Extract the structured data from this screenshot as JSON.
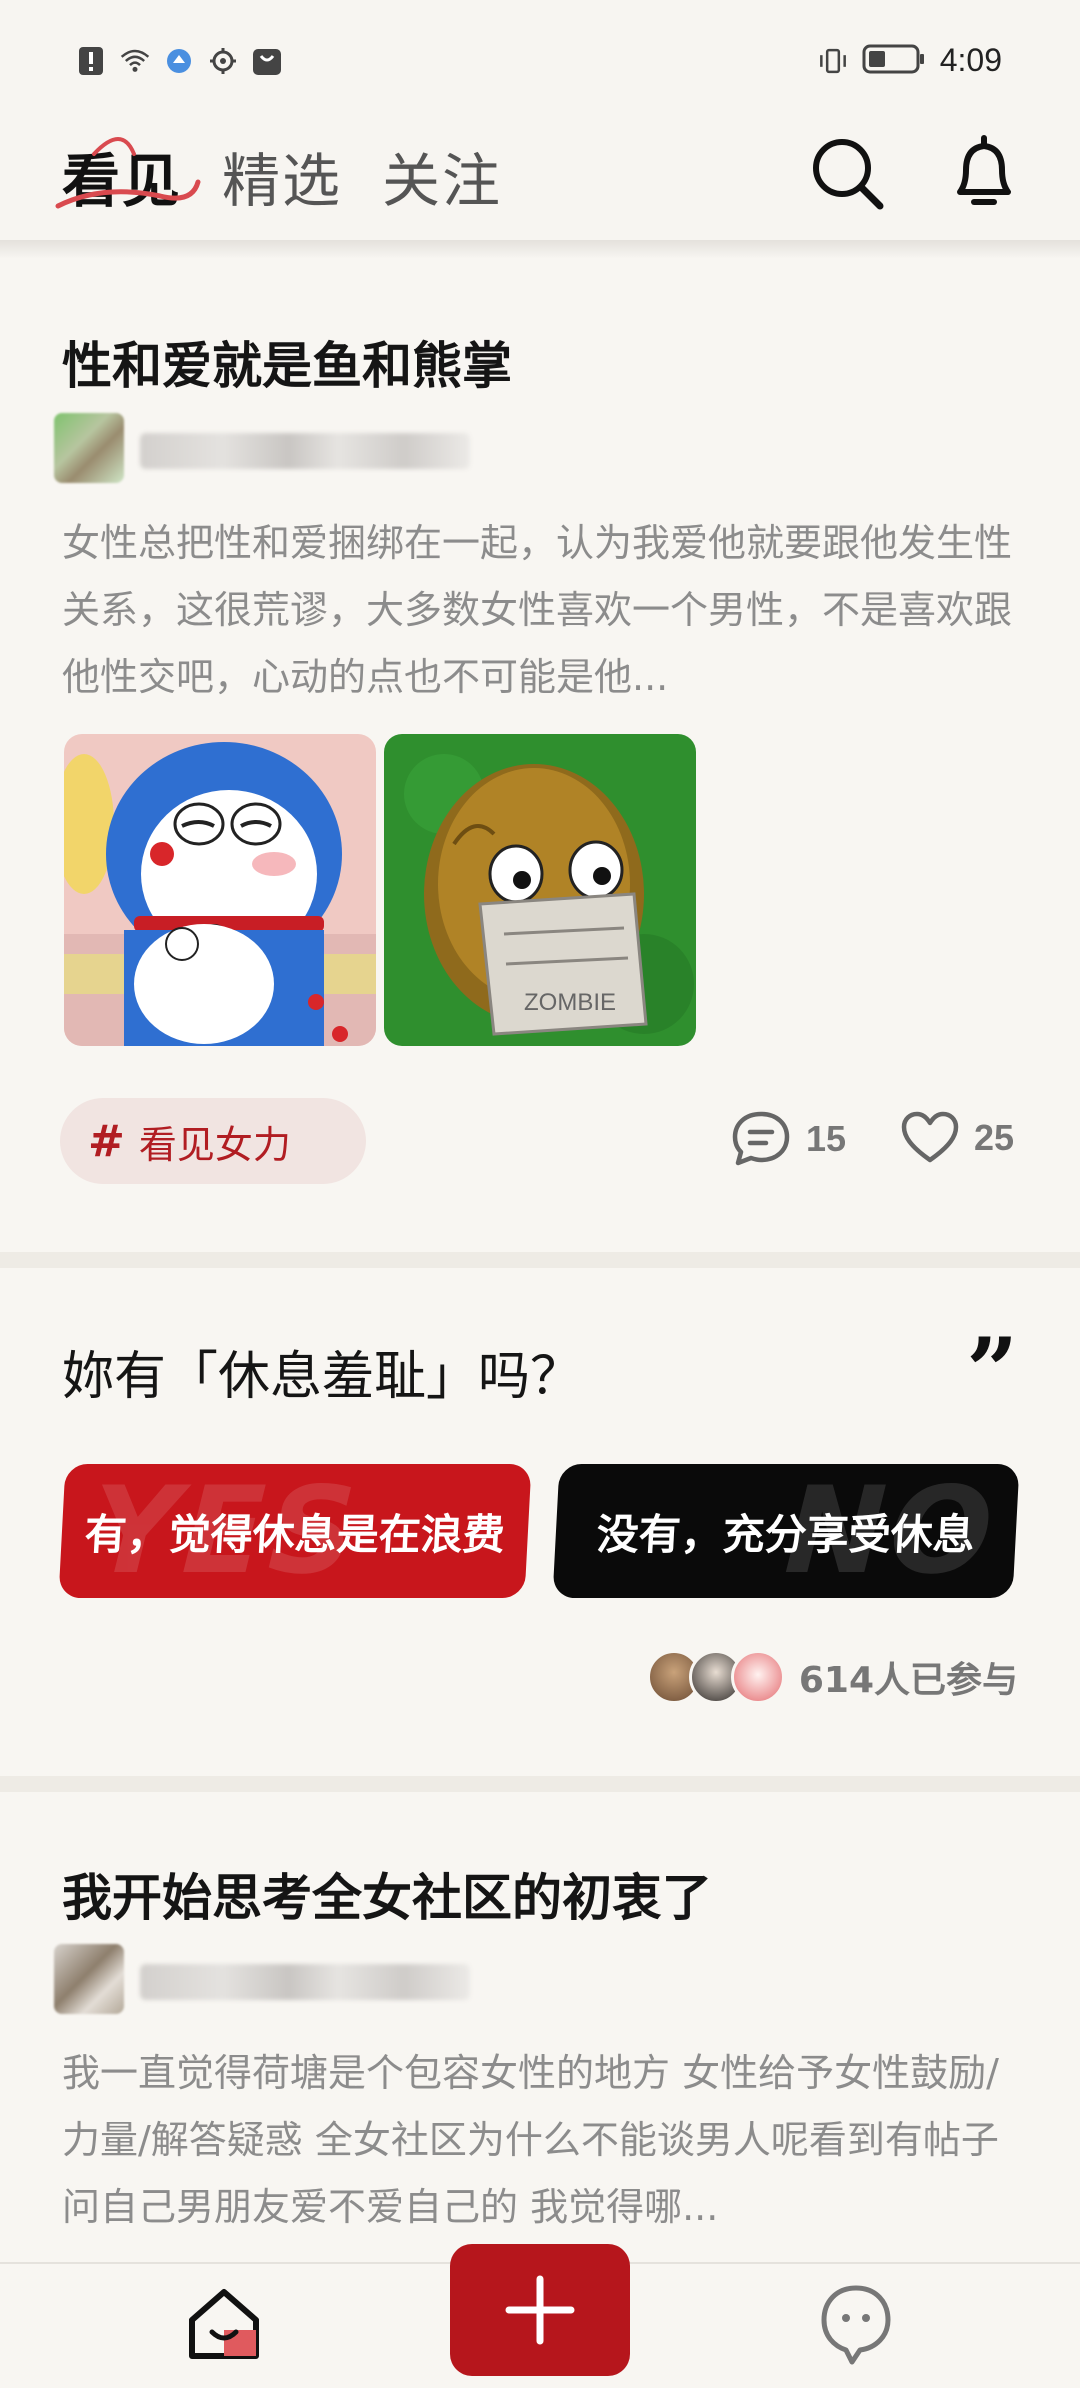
{
  "status_bar": {
    "time": "4:09"
  },
  "header": {
    "tabs": [
      {
        "label": "看见"
      },
      {
        "label": "精选"
      },
      {
        "label": "关注"
      }
    ]
  },
  "post1": {
    "title": "性和爱就是鱼和熊掌",
    "body": "女性总把性和爱捆绑在一起，认为我爱他就要跟他发生性关系，这很荒谬，大多数女性喜欢一个男性，不是喜欢跟他性交吧，心动的点也不可能是他...",
    "tag": "看见女力",
    "comments": "15",
    "likes": "25"
  },
  "poll": {
    "question": "妳有「休息羞耻」吗？",
    "quote": "”",
    "option_yes": "有，觉得休息是在浪费",
    "option_no": "没有，充分享受休息",
    "yes_bg": "YES",
    "no_bg": "NO",
    "participants": "614人已参与"
  },
  "post2": {
    "title": "我开始思考全女社区的初衷了",
    "body": "我一直觉得荷塘是个包容女性的地方 女性给予女性鼓励/力量/解答疑惑 全女社区为什么不能谈男人呢看到有帖子问自己男朋友爱不爱自己的 我觉得哪..."
  },
  "colors": {
    "accent_red": "#b6161c",
    "poll_yes": "#c8161c",
    "poll_no": "#0a0a0a",
    "tag_bg": "#f1e4e1"
  }
}
